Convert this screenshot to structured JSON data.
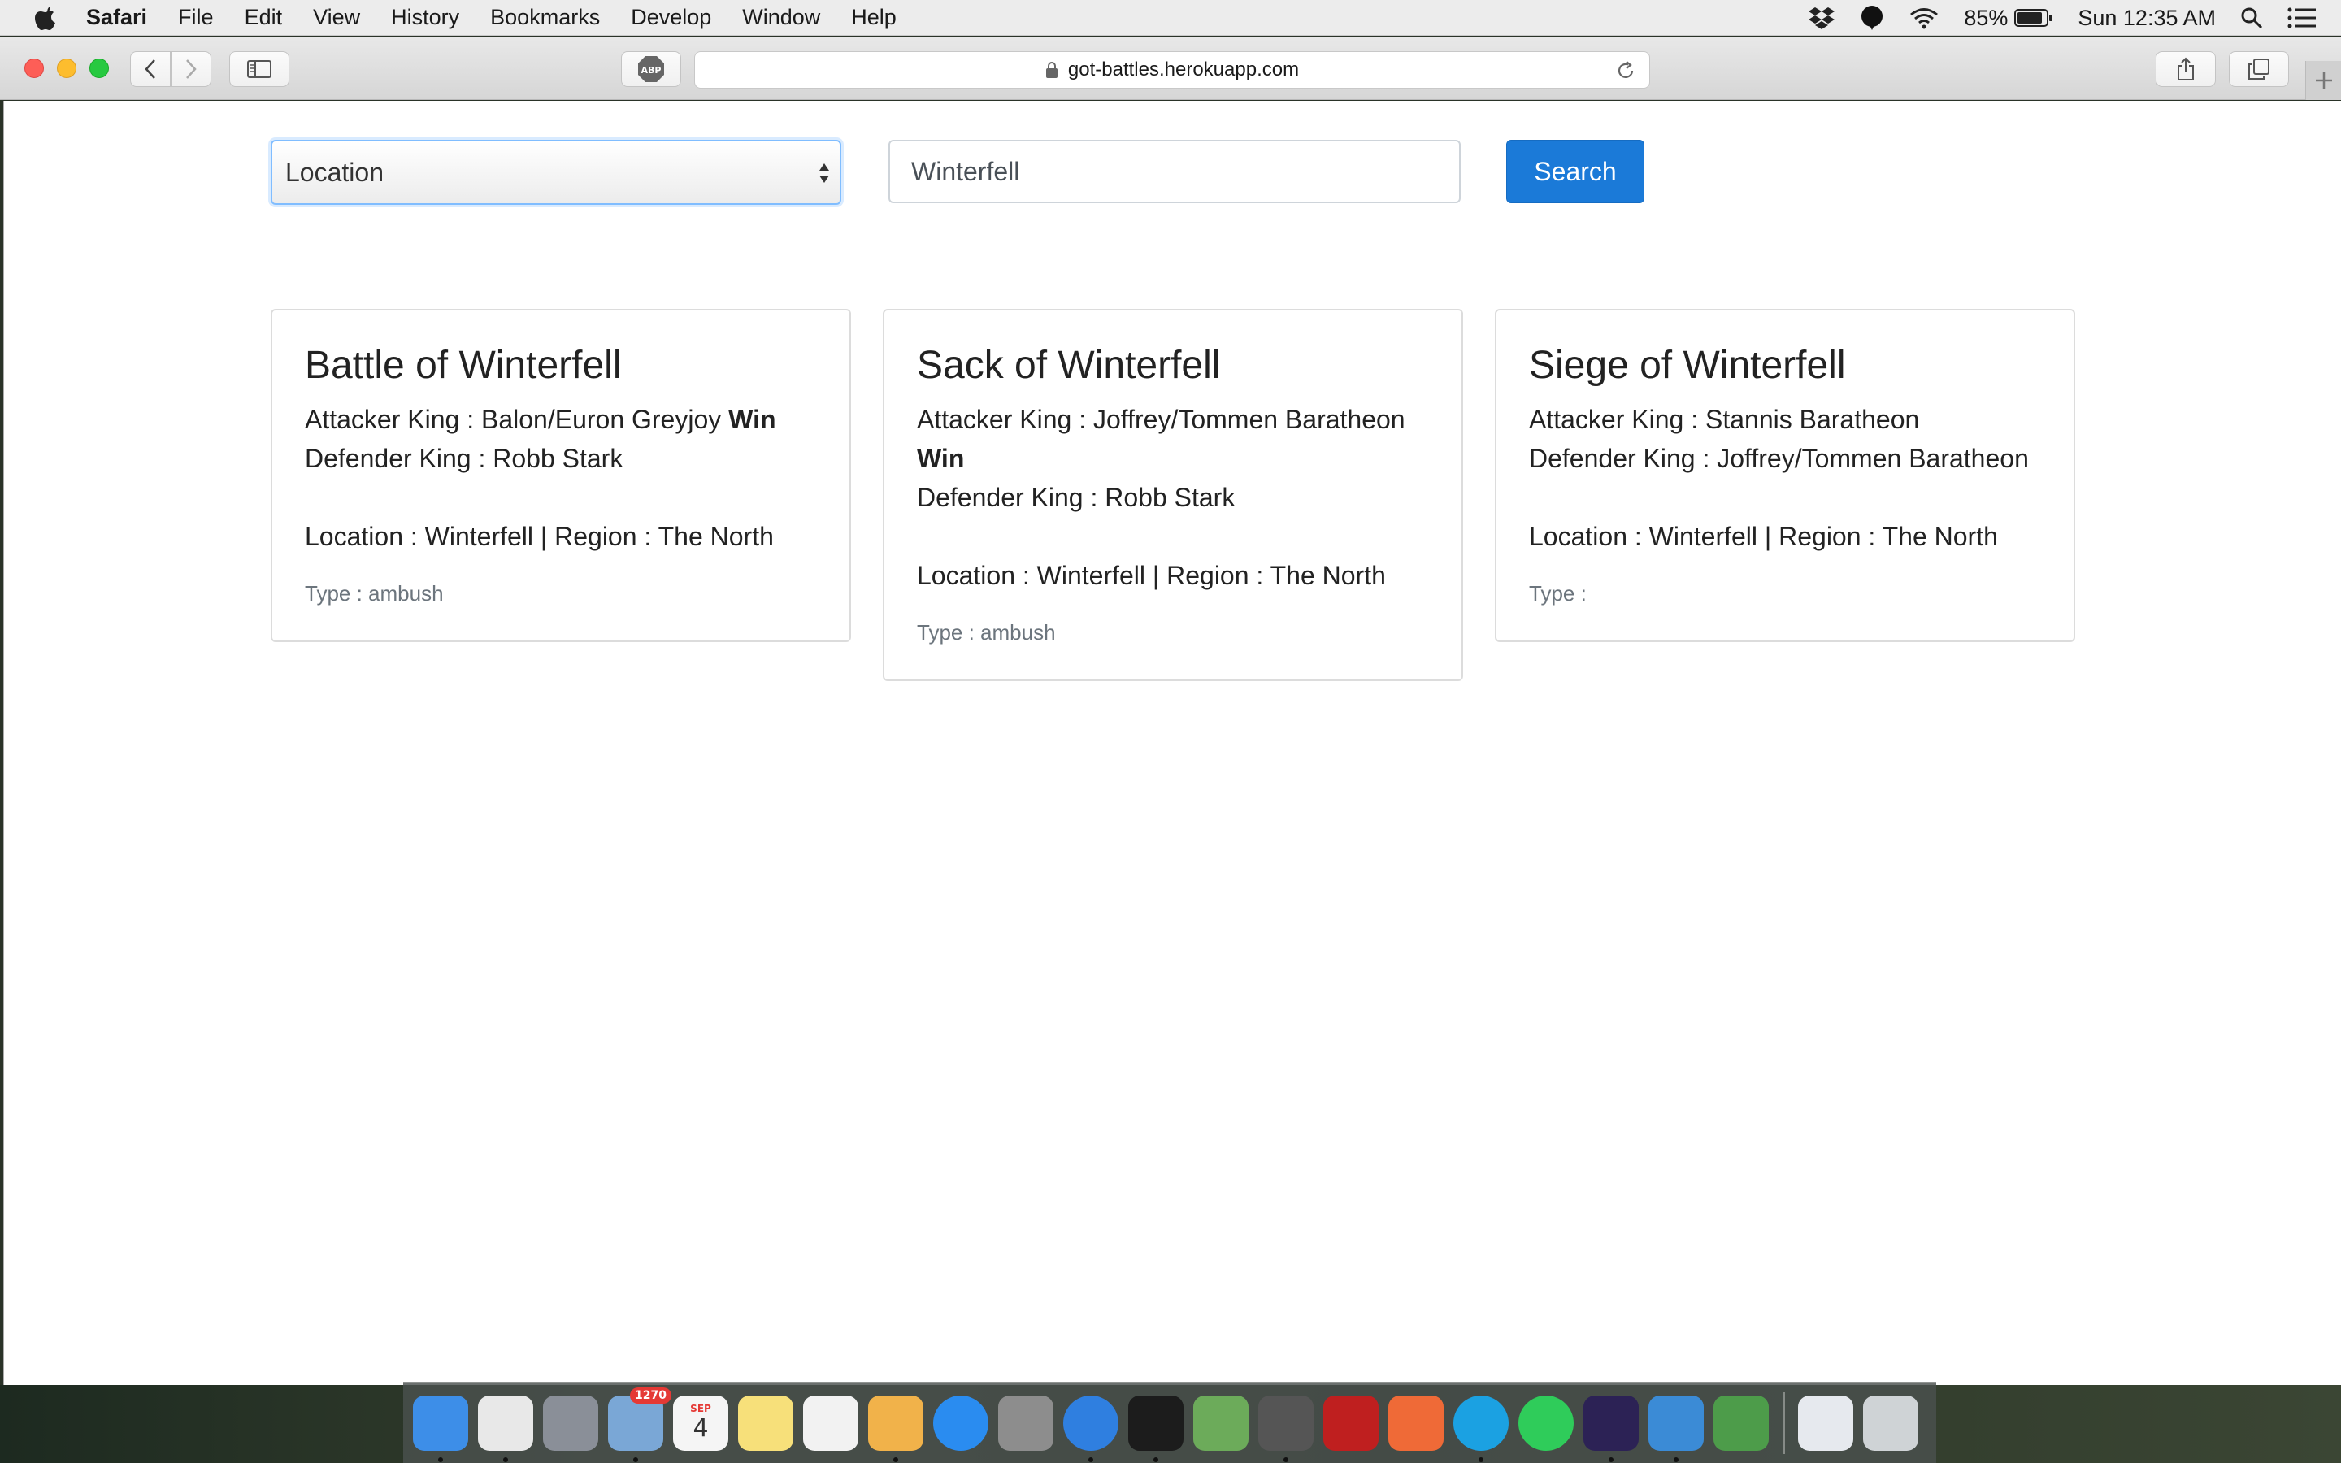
{
  "menubar": {
    "app_name": "Safari",
    "menus": [
      "File",
      "Edit",
      "View",
      "History",
      "Bookmarks",
      "Develop",
      "Window",
      "Help"
    ],
    "battery_percent": "85%",
    "clock": "Sun 12:35 AM"
  },
  "browser": {
    "url": "got-battles.herokuapp.com",
    "extension_label": "ABP"
  },
  "search": {
    "filter_selected": "Location",
    "query_value": "Winterfell",
    "button_label": "Search"
  },
  "cards": [
    {
      "title": "Battle of Winterfell",
      "attacker_label": "Attacker King : Balon/Euron Greyjoy",
      "attacker_result": "Win",
      "defender_label": "Defender King : Robb Stark",
      "location_label": "Location : Winterfell | Region : The North",
      "type_label": "Type : ambush"
    },
    {
      "title": "Sack of Winterfell",
      "attacker_label": "Attacker King : Joffrey/Tommen Baratheon",
      "attacker_result": "Win",
      "defender_label": "Defender King : Robb Stark",
      "location_label": "Location : Winterfell | Region : The North",
      "type_label": "Type : ambush"
    },
    {
      "title": "Siege of Winterfell",
      "attacker_label": "Attacker King : Stannis Baratheon",
      "attacker_result": "",
      "defender_label": "Defender King : Joffrey/Tommen Baratheon",
      "location_label": "Location : Winterfell | Region : The North",
      "type_label": "Type :"
    }
  ],
  "dock": {
    "apps": [
      {
        "name": "finder-icon",
        "color": "#3d8ee8"
      },
      {
        "name": "chrome-icon",
        "color": "#e8e8e8"
      },
      {
        "name": "launchpad-icon",
        "color": "#8a8f98"
      },
      {
        "name": "mail-icon",
        "color": "#7aa7d6",
        "badge": "1270"
      },
      {
        "name": "calendar-icon",
        "color": "#f5f5f5",
        "month": "SEP",
        "day": "4"
      },
      {
        "name": "notes-icon",
        "color": "#f7e07a"
      },
      {
        "name": "reminders-icon",
        "color": "#f2f2f2"
      },
      {
        "name": "pages-icon",
        "color": "#f1b24a"
      },
      {
        "name": "app-store-icon",
        "color": "#2a8cf0"
      },
      {
        "name": "system-preferences-icon",
        "color": "#8d8d8d"
      },
      {
        "name": "safari-icon",
        "color": "#2f7fe0"
      },
      {
        "name": "terminal-icon",
        "color": "#1c1c1c"
      },
      {
        "name": "rocket-app-icon",
        "color": "#6cab5a"
      },
      {
        "name": "sublime-text-icon",
        "color": "#555555"
      },
      {
        "name": "filezilla-icon",
        "color": "#bf1f1f"
      },
      {
        "name": "postman-icon",
        "color": "#ef6a37"
      },
      {
        "name": "skype-icon",
        "color": "#1ba1e2"
      },
      {
        "name": "whatsapp-icon",
        "color": "#2fcc5a"
      },
      {
        "name": "eclipse-icon",
        "color": "#2c2255"
      },
      {
        "name": "xcode-icon",
        "color": "#3b8bd6"
      },
      {
        "name": "globe-app-icon",
        "color": "#4d9c4a"
      },
      {
        "name": "documents-icon",
        "color": "#e6e9ee"
      },
      {
        "name": "trash-icon",
        "color": "#cfd3d6"
      }
    ]
  }
}
